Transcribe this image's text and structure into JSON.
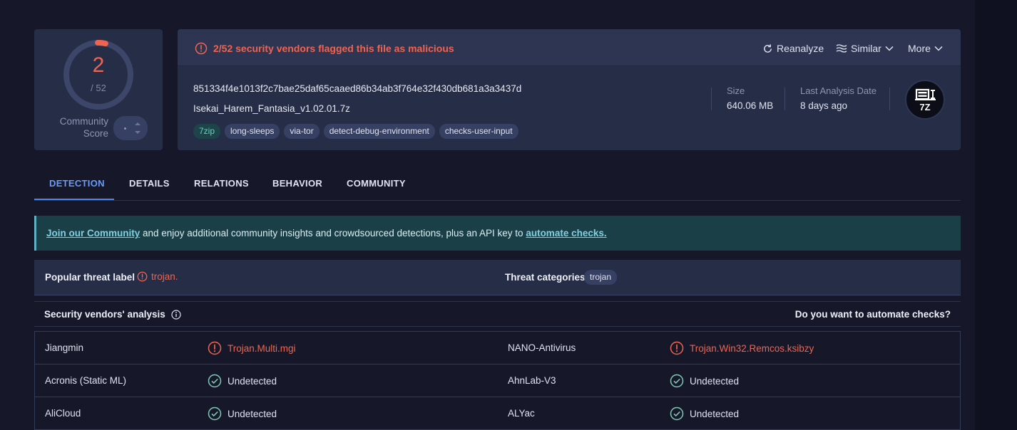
{
  "score": {
    "detections": "2",
    "total": "/ 52",
    "detection_fraction": 0.0385,
    "community_label_line1": "Community",
    "community_label_line2": "Score",
    "community_value": "·"
  },
  "header": {
    "alert": "2/52 security vendors flagged this file as malicious",
    "reanalyze": "Reanalyze",
    "similar": "Similar",
    "more": "More"
  },
  "file": {
    "hash": "851334f4e1013f2c7bae25daf65caaed86b34ab3f764e32f430db681a3a3437d",
    "name": "Isekai_Harem_Fantasia_v1.02.01.7z",
    "type_tag": "7zip",
    "tags": [
      "long-sleeps",
      "via-tor",
      "detect-debug-environment",
      "checks-user-input"
    ],
    "size_label": "Size",
    "size_value": "640.06 MB",
    "date_label": "Last Analysis Date",
    "date_value": "8 days ago",
    "icon_text": "7Z"
  },
  "tabs": [
    "DETECTION",
    "DETAILS",
    "RELATIONS",
    "BEHAVIOR",
    "COMMUNITY"
  ],
  "banner": {
    "link1": "Join our Community",
    "middle": " and enjoy additional community insights and crowdsourced detections, plus an API key to ",
    "link2": "automate checks."
  },
  "threat": {
    "label": "Popular threat label",
    "value": "trojan.",
    "categories_label": "Threat categories",
    "category": "trojan"
  },
  "vendors": {
    "title": "Security vendors' analysis",
    "automate": "Do you want to automate checks?",
    "rows": [
      [
        {
          "name": "Jiangmin",
          "result": "Trojan.Multi.mgi",
          "status": "malicious"
        },
        {
          "name": "NANO-Antivirus",
          "result": "Trojan.Win32.Remcos.ksibzy",
          "status": "malicious"
        }
      ],
      [
        {
          "name": "Acronis (Static ML)",
          "result": "Undetected",
          "status": "undetected"
        },
        {
          "name": "AhnLab-V3",
          "result": "Undetected",
          "status": "undetected"
        }
      ],
      [
        {
          "name": "AliCloud",
          "result": "Undetected",
          "status": "undetected"
        },
        {
          "name": "ALYac",
          "result": "Undetected",
          "status": "undetected"
        }
      ]
    ]
  },
  "colors": {
    "malicious": "#f0644f",
    "ok": "#7fc9b4",
    "accent": "#4f86ee"
  }
}
